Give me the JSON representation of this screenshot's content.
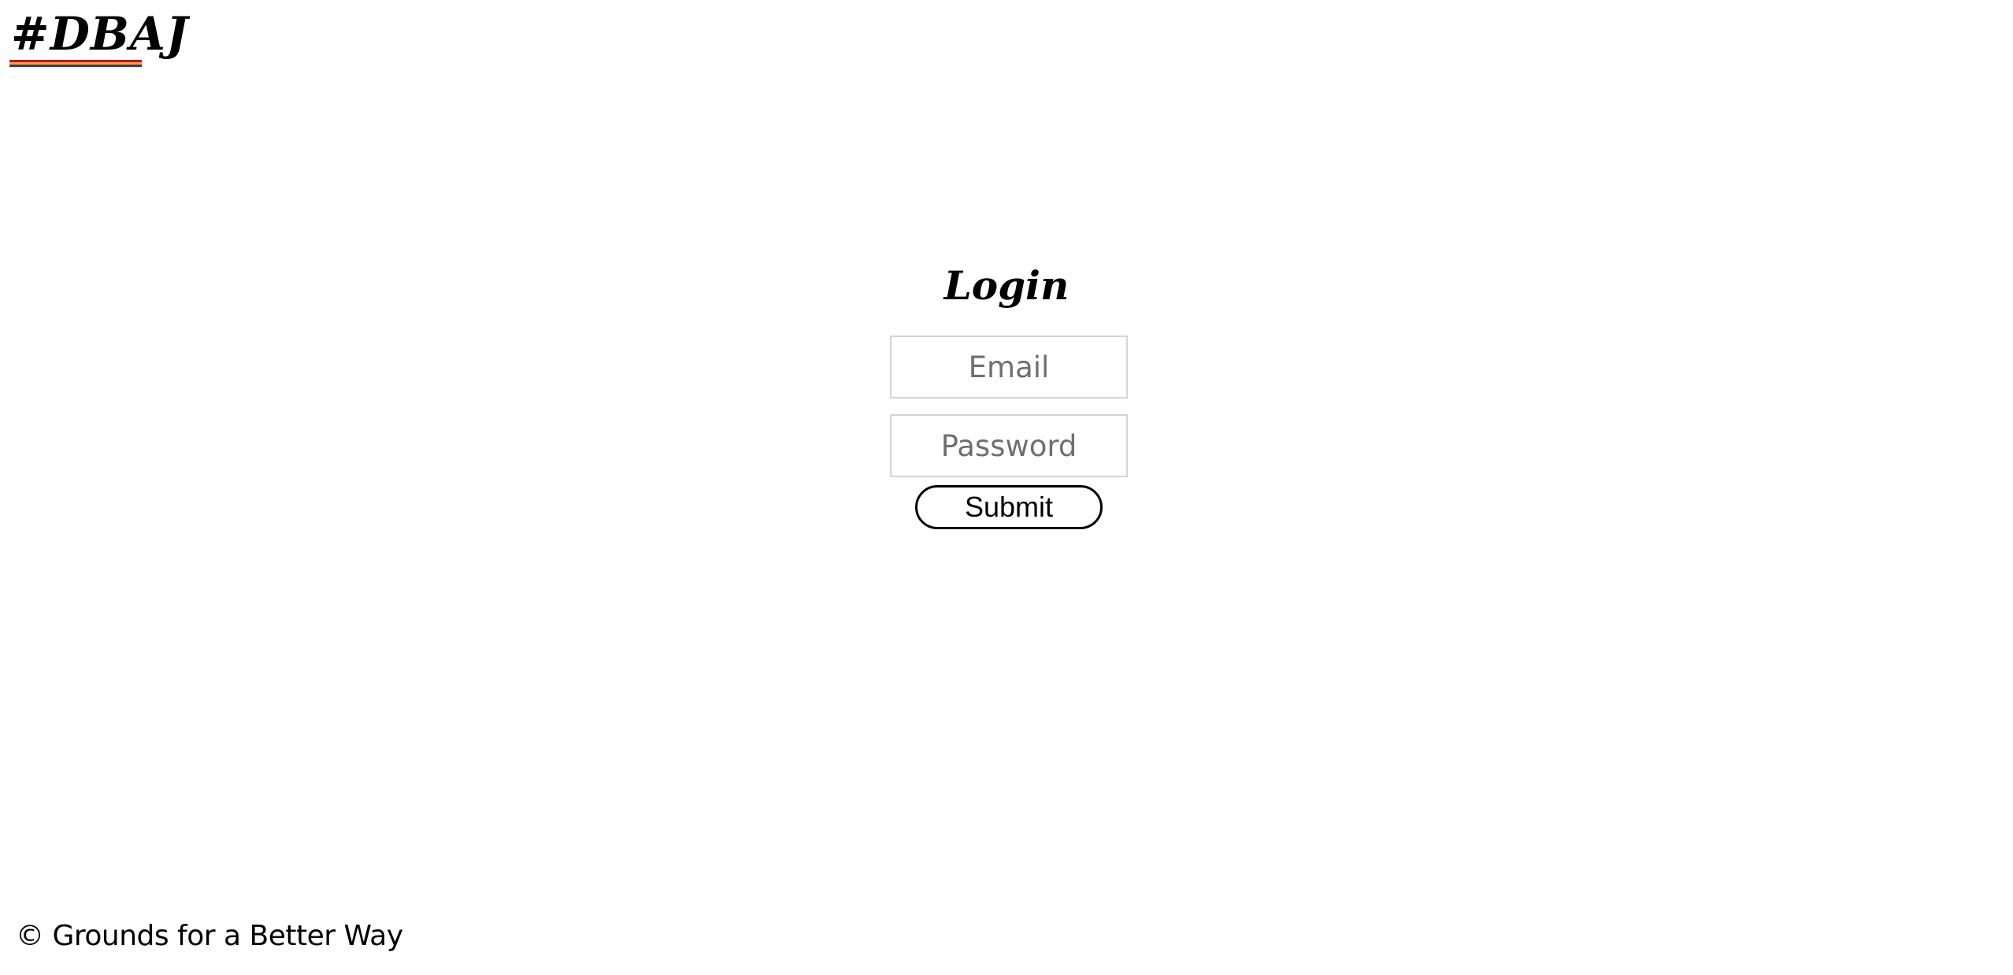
{
  "header": {
    "logo_text": "#DBAJ",
    "logo_stripe_colors": [
      "#c8102e",
      "#f5a623",
      "#1a3fa6"
    ]
  },
  "login": {
    "title": "Login",
    "email_placeholder": "Email",
    "password_placeholder": "Password",
    "submit_label": "Submit"
  },
  "footer": {
    "copyright": "© Grounds for a Better Way"
  }
}
